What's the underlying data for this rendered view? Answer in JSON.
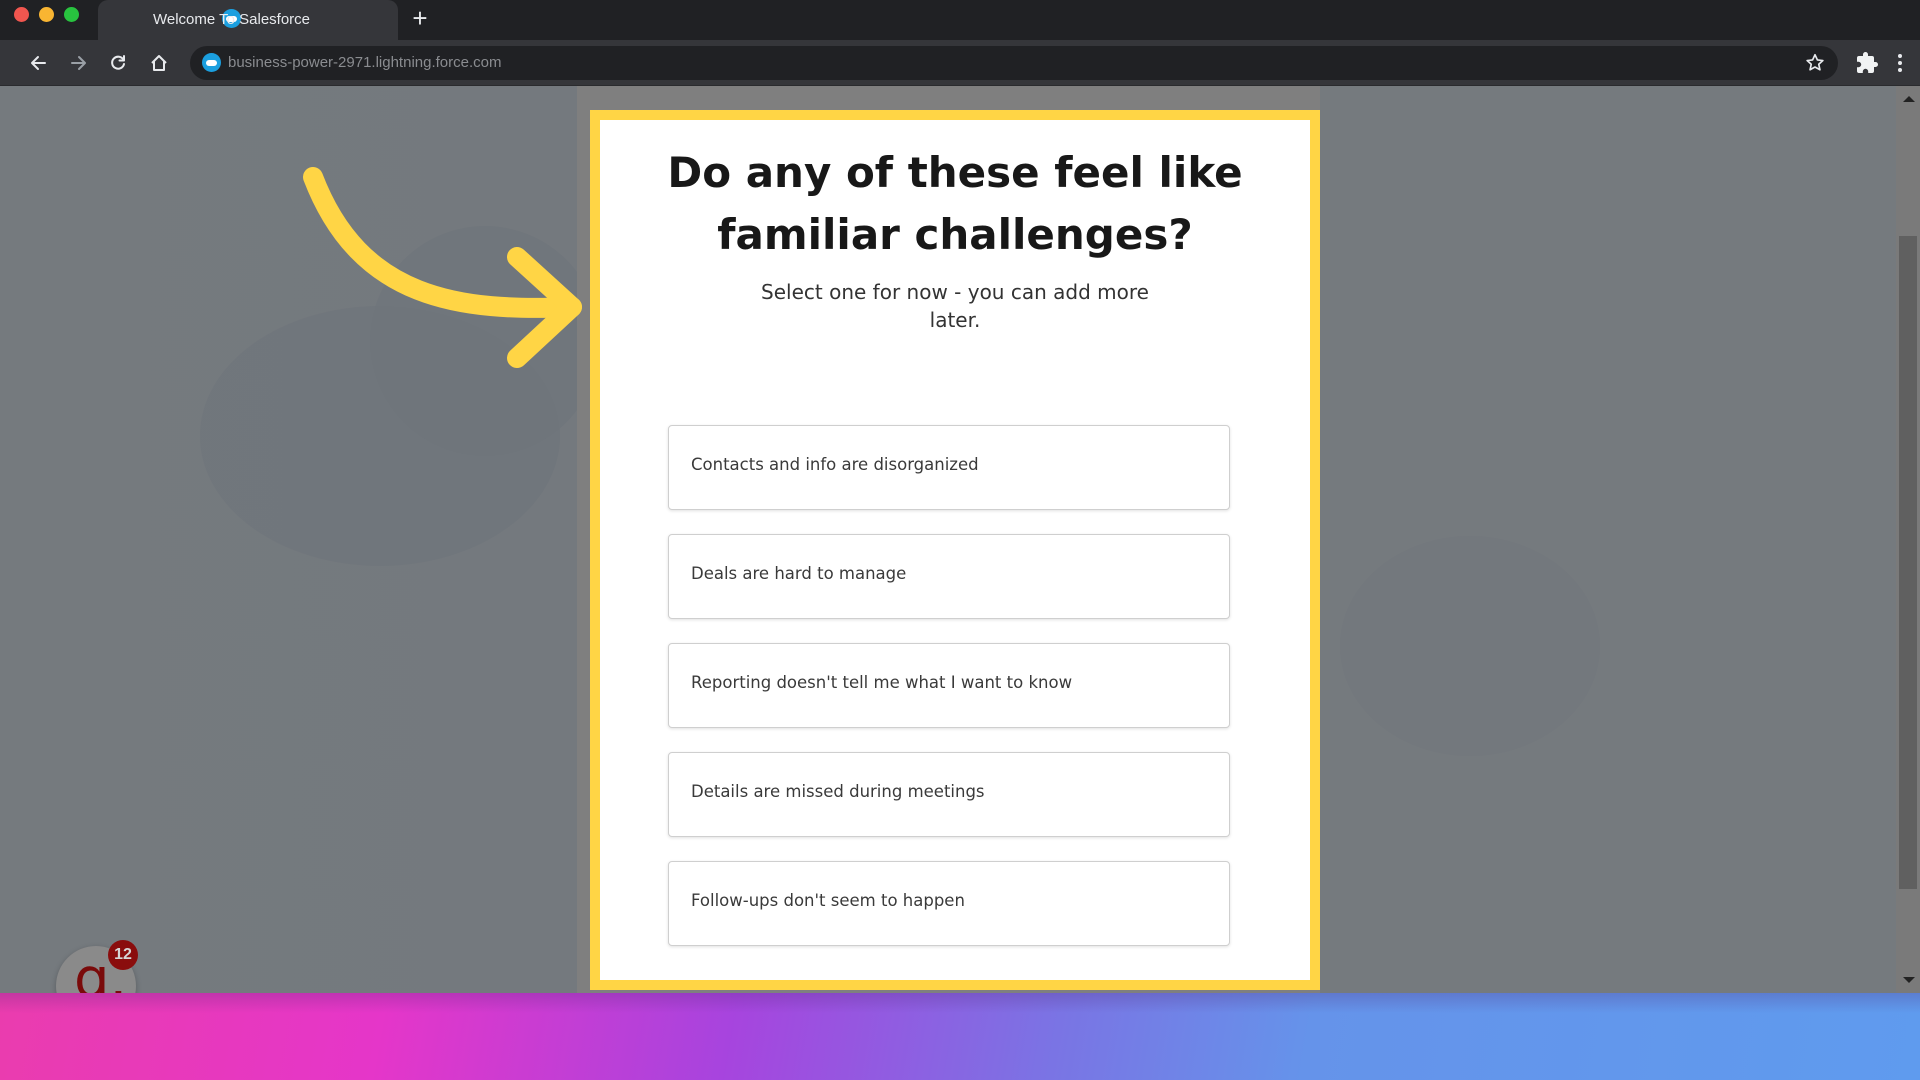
{
  "browser": {
    "tab": {
      "title": "Welcome To Salesforce",
      "favicon": "salesforce-cloud-icon"
    },
    "new_tab_label": "+",
    "address_bar": {
      "url": "business-power-2971.lightning.force.com"
    },
    "icons": {
      "back": "arrow-left-icon",
      "forward": "arrow-right-icon",
      "reload": "reload-icon",
      "home": "home-icon",
      "bookmark": "star-icon",
      "extensions": "puzzle-icon",
      "menu": "kebab-menu-icon"
    }
  },
  "dialog": {
    "title": "Do any of these feel like familiar challenges?",
    "subtitle": "Select one for now - you can add more later.",
    "options": [
      {
        "label": "Contacts and info are disorganized"
      },
      {
        "label": "Deals are hard to manage"
      },
      {
        "label": "Reporting doesn't tell me what I want to know"
      },
      {
        "label": "Details are missed during meetings"
      },
      {
        "label": "Follow-ups don't seem to happen"
      }
    ]
  },
  "annotation": {
    "type": "curved-arrow",
    "color": "#ffd545"
  },
  "widget": {
    "letter": "g.",
    "badge_count": "12",
    "badge_color": "#8a0d0d",
    "letter_color": "#7a0a0a"
  },
  "colors": {
    "highlight": "#ffd545",
    "gradient": [
      "#ea3cae",
      "#e536c9",
      "#a744de",
      "#6593ea",
      "#5f9bee"
    ]
  }
}
